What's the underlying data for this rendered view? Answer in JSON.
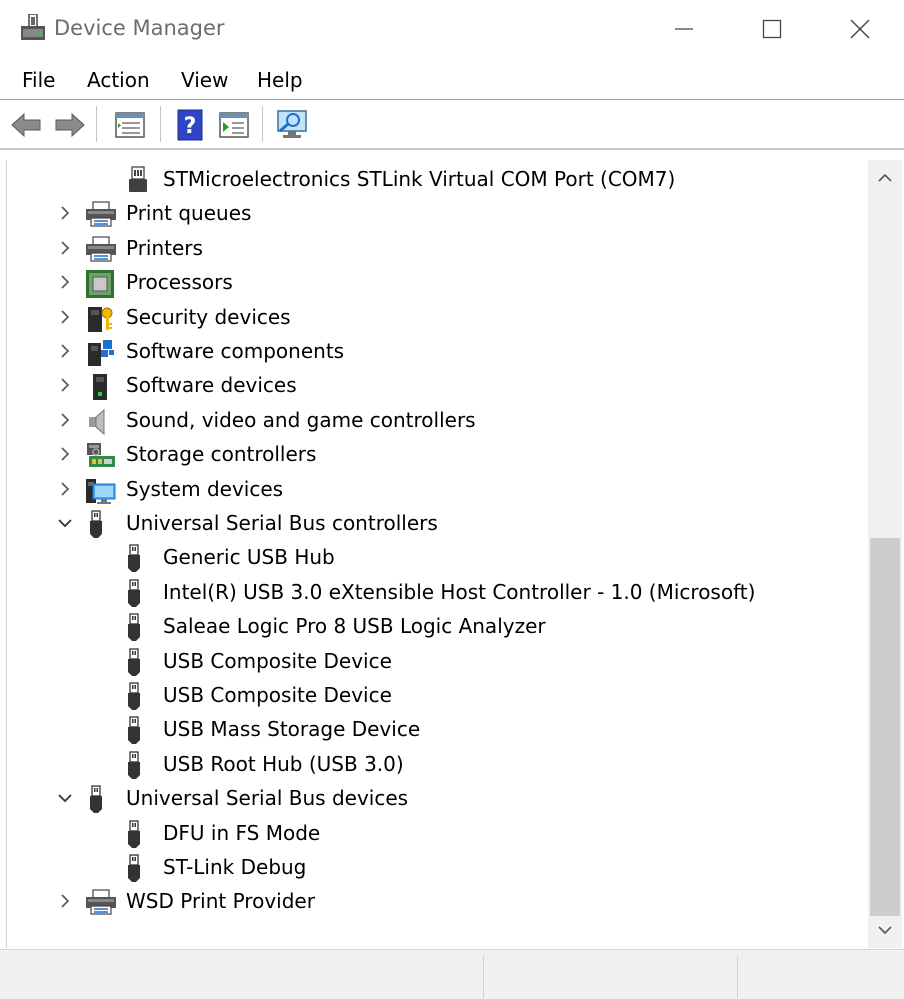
{
  "window": {
    "title": "Device Manager"
  },
  "menu": {
    "file": "File",
    "action": "Action",
    "view": "View",
    "help": "Help"
  },
  "toolbar": [
    "back-icon",
    "forward-icon",
    "properties-icon",
    "help-icon",
    "update-driver-icon",
    "scan-hardware-icon"
  ],
  "tree": [
    {
      "label": "STMicroelectronics STLink Virtual COM Port (COM7)",
      "icon": "port-icon",
      "level": 1
    },
    {
      "label": "Print queues",
      "icon": "printer-icon",
      "level": 0,
      "state": "collapsed"
    },
    {
      "label": "Printers",
      "icon": "printer-icon",
      "level": 0,
      "state": "collapsed"
    },
    {
      "label": "Processors",
      "icon": "processor-icon",
      "level": 0,
      "state": "collapsed"
    },
    {
      "label": "Security devices",
      "icon": "security-device-icon",
      "level": 0,
      "state": "collapsed"
    },
    {
      "label": "Software components",
      "icon": "software-component-icon",
      "level": 0,
      "state": "collapsed"
    },
    {
      "label": "Software devices",
      "icon": "software-device-icon",
      "level": 0,
      "state": "collapsed"
    },
    {
      "label": "Sound, video and game controllers",
      "icon": "speaker-icon",
      "level": 0,
      "state": "collapsed"
    },
    {
      "label": "Storage controllers",
      "icon": "storage-controller-icon",
      "level": 0,
      "state": "collapsed"
    },
    {
      "label": "System devices",
      "icon": "system-device-icon",
      "level": 0,
      "state": "collapsed"
    },
    {
      "label": "Universal Serial Bus controllers",
      "icon": "usb-icon",
      "level": 0,
      "state": "expanded"
    },
    {
      "label": "Generic USB Hub",
      "icon": "usb-icon",
      "level": 1
    },
    {
      "label": "Intel(R) USB 3.0 eXtensible Host Controller - 1.0 (Microsoft)",
      "icon": "usb-icon",
      "level": 1
    },
    {
      "label": "Saleae Logic Pro 8 USB Logic Analyzer",
      "icon": "usb-icon",
      "level": 1
    },
    {
      "label": "USB Composite Device",
      "icon": "usb-icon",
      "level": 1
    },
    {
      "label": "USB Composite Device",
      "icon": "usb-icon",
      "level": 1
    },
    {
      "label": "USB Mass Storage Device",
      "icon": "usb-icon",
      "level": 1
    },
    {
      "label": "USB Root Hub (USB 3.0)",
      "icon": "usb-icon",
      "level": 1
    },
    {
      "label": "Universal Serial Bus devices",
      "icon": "usb-icon",
      "level": 0,
      "state": "expanded"
    },
    {
      "label": "DFU in FS Mode",
      "icon": "usb-icon",
      "level": 1
    },
    {
      "label": "ST-Link Debug",
      "icon": "usb-icon",
      "level": 1
    },
    {
      "label": "WSD Print Provider",
      "icon": "printer-icon",
      "level": 0,
      "state": "collapsed"
    }
  ],
  "colors": {
    "titleText": "#6d6d6d",
    "scrollThumb": "#cdcdcd",
    "statusBar": "#f0f0f0",
    "accentBlue": "#1f6fd1"
  }
}
